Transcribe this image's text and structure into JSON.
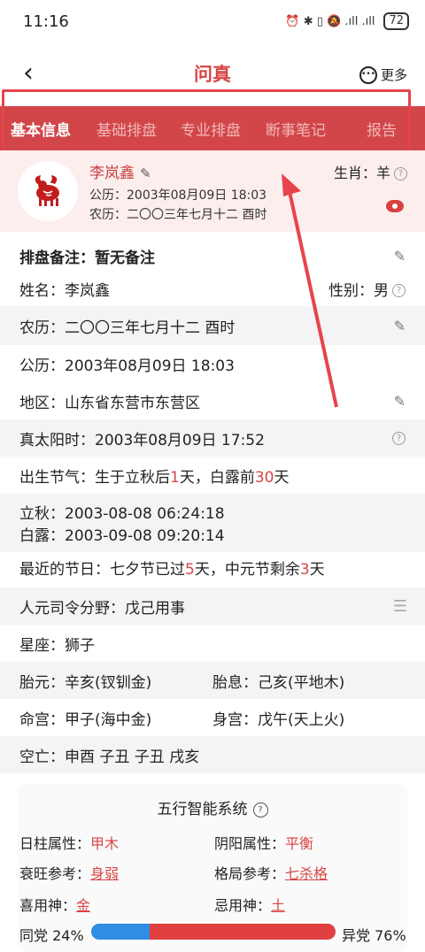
{
  "status": {
    "time": "11:16",
    "icons_text": "⏰ ✱ ▯ 🔕 .ıll .ıll",
    "battery": "72"
  },
  "nav": {
    "title": "问真",
    "more": "更多"
  },
  "tabs": [
    "基本信息",
    "基础排盘",
    "专业排盘",
    "断事笔记",
    "报告"
  ],
  "profile": {
    "name": "李岚鑫",
    "solar": "公历：2003年08月09日 18:03",
    "lunar": "农历：二〇〇三年七月十二  酉时",
    "zodiac_label": "生肖：",
    "zodiac_value": "羊"
  },
  "rows": {
    "note": "排盘备注：暂无备注",
    "name": "姓名：李岚鑫",
    "gender": "性别：男",
    "lunar": "农历：二〇〇三年七月十二  酉时",
    "solar": "公历：2003年08月09日 18:03",
    "region": "地区：山东省东营市东营区",
    "true_solar": "真太阳时：2003年08月09日 17:52",
    "term_prefix": "出生节气：生于立秋后",
    "term_days1": "1",
    "term_mid": "天，白露前",
    "term_days2": "30",
    "term_suffix": "天",
    "liqiu": "立秋：2003-08-08 06:24:18",
    "bailu": "白露：2003-09-08 09:20:14",
    "festival_prefix": "最近的节日：七夕节已过",
    "festival_n1": "5",
    "festival_mid": "天，中元节剩余",
    "festival_n2": "3",
    "festival_suffix": "天",
    "renyuan": "人元司令分野：戊己用事",
    "constellation": "星座：狮子",
    "taiyuan": "胎元：辛亥(钗钏金)",
    "taixi": "胎息：己亥(平地木)",
    "minggong": "命宫：甲子(海中金)",
    "shengong": "身宫：戊午(天上火)",
    "kongwang": "空亡：申酉 子丑 子丑 戌亥"
  },
  "wuxing": {
    "title": "五行智能系统",
    "rizhu_label": "日柱属性：",
    "rizhu": "甲木",
    "yinyang_label": "阴阳属性：",
    "yinyang": "平衡",
    "shuaiwang_label": "衰旺参考：",
    "shuaiwang": "身弱",
    "geju_label": "格局参考：",
    "geju": "七杀格",
    "xiyong_label": "喜用神：",
    "xiyong": "金",
    "jiyong_label": "忌用神：",
    "jiyong": "土",
    "tong_label": "同党 24%",
    "yi_label": "异党 76%",
    "tong_pct": 24,
    "yi_pct": 76
  },
  "colors": {
    "accent": "#d94545",
    "tabbar": "#d2464a",
    "annotation": "#e8434a",
    "tong": "#2f8de4",
    "yi": "#e04040"
  }
}
